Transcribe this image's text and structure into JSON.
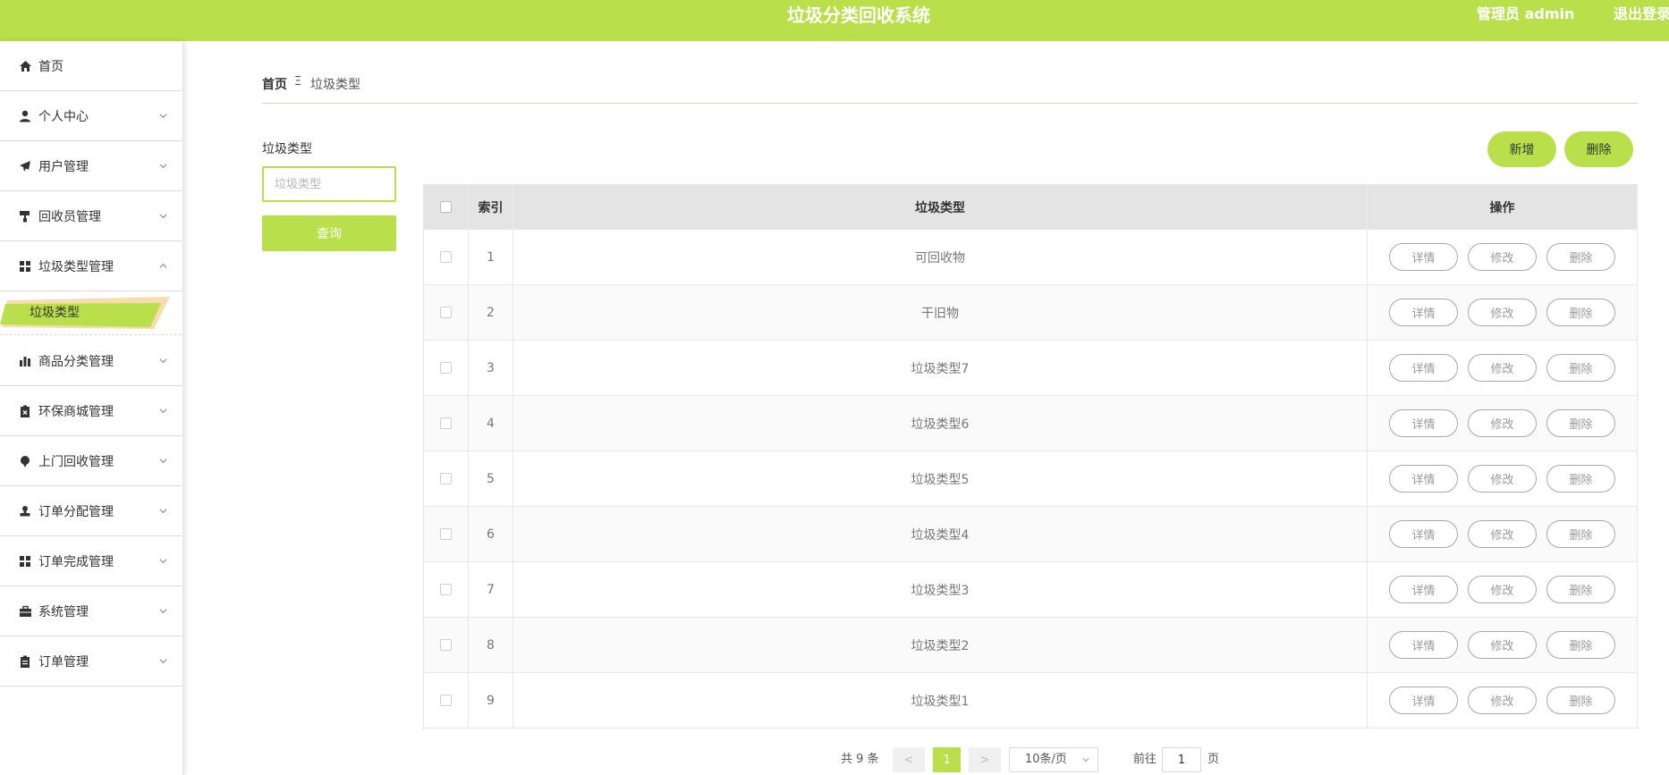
{
  "header": {
    "title": "垃圾分类回收系统",
    "admin_label": "管理员 admin",
    "logout_label": "退出登录",
    "accent_color": "#b9e04a"
  },
  "sidebar": {
    "items": [
      {
        "label": "首页",
        "icon": "home-icon",
        "expandable": false
      },
      {
        "label": "个人中心",
        "icon": "user-icon",
        "expandable": true
      },
      {
        "label": "用户管理",
        "icon": "paper-plane-icon",
        "expandable": true
      },
      {
        "label": "回收员管理",
        "icon": "paint-roller-icon",
        "expandable": true
      },
      {
        "label": "垃圾类型管理",
        "icon": "grid-icon",
        "expandable": true,
        "expanded": true
      },
      {
        "label": "商品分类管理",
        "icon": "bar-chart-icon",
        "expandable": true
      },
      {
        "label": "环保商城管理",
        "icon": "clipboard-x-icon",
        "expandable": true
      },
      {
        "label": "上门回收管理",
        "icon": "location-icon",
        "expandable": true
      },
      {
        "label": "订单分配管理",
        "icon": "stamp-icon",
        "expandable": true
      },
      {
        "label": "订单完成管理",
        "icon": "grid-icon",
        "expandable": true
      },
      {
        "label": "系统管理",
        "icon": "briefcase-icon",
        "expandable": true
      },
      {
        "label": "订单管理",
        "icon": "clipboard-icon",
        "expandable": true
      }
    ],
    "active_sub_item": "垃圾类型"
  },
  "breadcrumb": {
    "home": "首页",
    "separator": "Ξ",
    "current": "垃圾类型"
  },
  "search": {
    "label": "垃圾类型",
    "placeholder": "垃圾类型",
    "value": "",
    "button_label": "查询"
  },
  "toolbar": {
    "add_label": "新增",
    "delete_label": "删除"
  },
  "table": {
    "columns": [
      "",
      "索引",
      "垃圾类型",
      "操作"
    ],
    "rows": [
      {
        "index": "1",
        "type": "可回收物"
      },
      {
        "index": "2",
        "type": "干旧物"
      },
      {
        "index": "3",
        "type": "垃圾类型7"
      },
      {
        "index": "4",
        "type": "垃圾类型6"
      },
      {
        "index": "5",
        "type": "垃圾类型5"
      },
      {
        "index": "6",
        "type": "垃圾类型4"
      },
      {
        "index": "7",
        "type": "垃圾类型3"
      },
      {
        "index": "8",
        "type": "垃圾类型2"
      },
      {
        "index": "9",
        "type": "垃圾类型1"
      }
    ],
    "row_actions": {
      "detail": "详情",
      "edit": "修改",
      "delete": "删除"
    }
  },
  "pagination": {
    "total_text": "共 9 条",
    "prev": "<",
    "current_page": "1",
    "next": ">",
    "page_size": "10条/页",
    "goto_label": "前往",
    "goto_value": "1",
    "goto_unit": "页"
  }
}
